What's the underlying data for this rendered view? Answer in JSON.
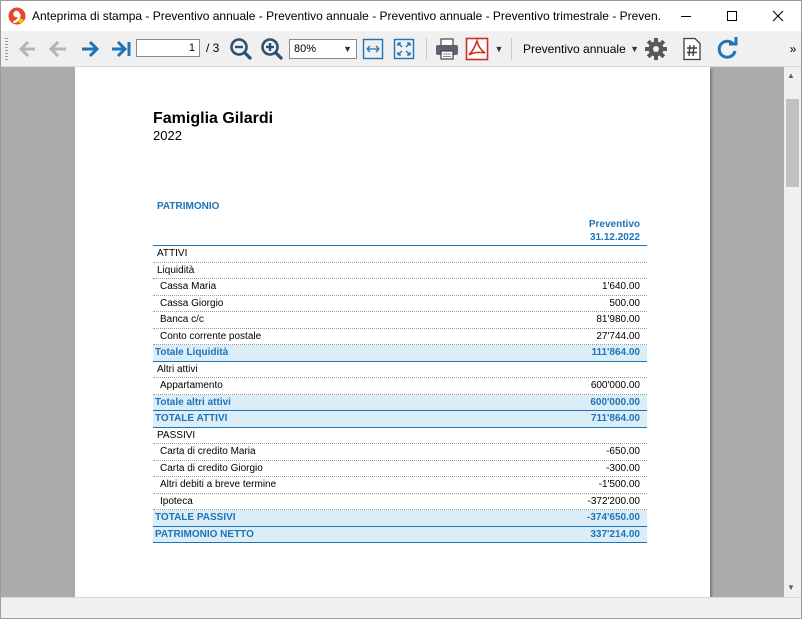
{
  "window": {
    "title": "Anteprima di stampa - Preventivo annuale - Preventivo annuale - Preventivo annuale - Preventivo trimestrale - Preven..."
  },
  "toolbar": {
    "page_value": "1",
    "page_total": "/ 3",
    "zoom": "80%",
    "layout": "Preventivo annuale",
    "overflow": "»"
  },
  "colors": {
    "accent": "#1f73b7",
    "total_bg": "#dbeef8",
    "nav_arrow": "#1f73b7"
  },
  "report": {
    "title": "Famiglia Gilardi",
    "year": "2022",
    "section": "PATRIMONIO",
    "column_header_1": "Preventivo",
    "column_header_2": "31.12.2022",
    "rows": [
      {
        "label": "ATTIVI",
        "value": "",
        "kind": "group"
      },
      {
        "label": "Liquidità",
        "value": "",
        "kind": "group"
      },
      {
        "label": "Cassa Maria",
        "value": "1'640.00",
        "kind": "item"
      },
      {
        "label": "Cassa Giorgio",
        "value": "500.00",
        "kind": "item"
      },
      {
        "label": "Banca c/c",
        "value": "81'980.00",
        "kind": "item"
      },
      {
        "label": "Conto corrente postale",
        "value": "27'744.00",
        "kind": "item"
      },
      {
        "label": "Totale Liquidità",
        "value": "111'864.00",
        "kind": "total"
      },
      {
        "label": "Altri attivi",
        "value": "",
        "kind": "group"
      },
      {
        "label": "Appartamento",
        "value": "600'000.00",
        "kind": "item"
      },
      {
        "label": "Totale altri attivi",
        "value": "600'000.00",
        "kind": "total"
      },
      {
        "label": "TOTALE ATTIVI",
        "value": "711'864.00",
        "kind": "total"
      },
      {
        "label": "PASSIVI",
        "value": "",
        "kind": "group"
      },
      {
        "label": "Carta di credito Maria",
        "value": "-650.00",
        "kind": "item"
      },
      {
        "label": "Carta di credito Giorgio",
        "value": "-300.00",
        "kind": "item"
      },
      {
        "label": "Altri debiti a breve termine",
        "value": "-1'500.00",
        "kind": "item"
      },
      {
        "label": "Ipoteca",
        "value": "-372'200.00",
        "kind": "item"
      },
      {
        "label": "TOTALE PASSIVI",
        "value": "-374'650.00",
        "kind": "total"
      },
      {
        "label": "PATRIMONIO NETTO",
        "value": "337'214.00",
        "kind": "total"
      }
    ]
  }
}
